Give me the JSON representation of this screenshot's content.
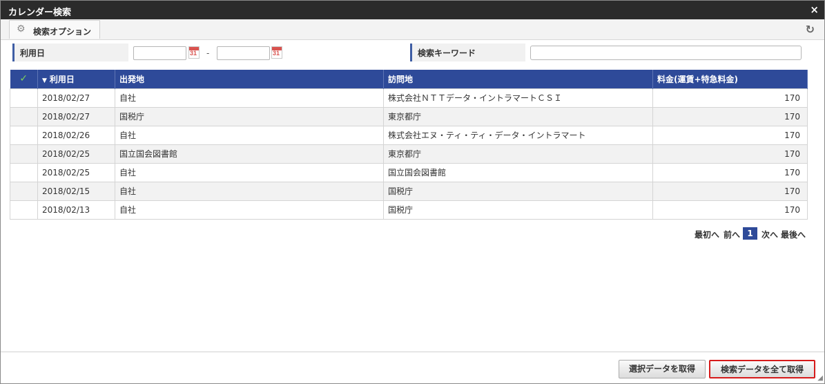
{
  "window": {
    "title": "カレンダー検索",
    "close_glyph": "×"
  },
  "toolbar": {
    "tab_label": "検索オプション",
    "refresh_glyph": "↻"
  },
  "conditions": {
    "date_label": "利用日",
    "date_separator": "-",
    "date_from": "",
    "date_to": "",
    "calendar_day": "31",
    "keyword_label": "検索キーワード",
    "keyword_value": ""
  },
  "table": {
    "check_glyph": "✓",
    "sort_glyph": "▼",
    "columns": [
      "利用日",
      "出発地",
      "訪問地",
      "料金(運賃+特急料金)"
    ],
    "rows": [
      [
        "2018/02/27",
        "自社",
        "株式会社ＮＴＴデータ・イントラマートＣＳＩ",
        "170"
      ],
      [
        "2018/02/27",
        "国税庁",
        "東京都庁",
        "170"
      ],
      [
        "2018/02/26",
        "自社",
        "株式会社エヌ・ティ・ティ・データ・イントラマート",
        "170"
      ],
      [
        "2018/02/25",
        "国立国会図書館",
        "東京都庁",
        "170"
      ],
      [
        "2018/02/25",
        "自社",
        "国立国会図書館",
        "170"
      ],
      [
        "2018/02/15",
        "自社",
        "国税庁",
        "170"
      ],
      [
        "2018/02/13",
        "自社",
        "国税庁",
        "170"
      ]
    ]
  },
  "pager": {
    "first": "最初へ",
    "prev": "前へ",
    "current": "1",
    "next": "次へ",
    "last": "最後へ"
  },
  "footer": {
    "select_button": "選択データを取得",
    "all_button": "検索データを全て取得"
  },
  "colors": {
    "header_bg": "#2e4a99",
    "titlebar_bg": "#2b2b2b",
    "highlight_border": "#d61a1a",
    "check": "#7fd35a"
  }
}
